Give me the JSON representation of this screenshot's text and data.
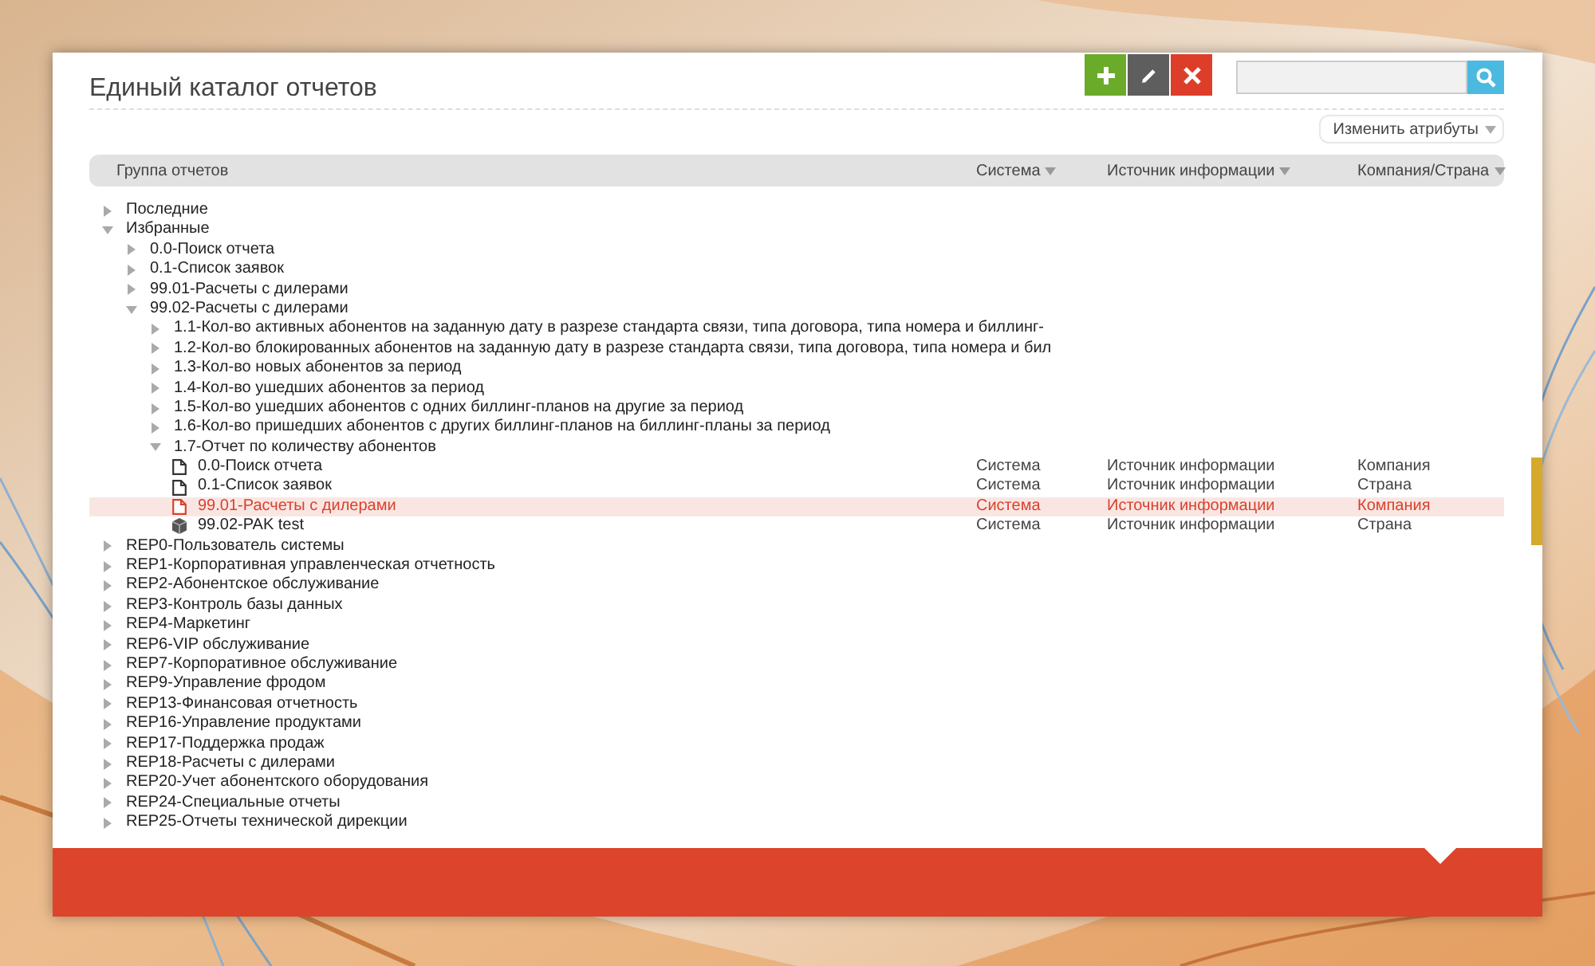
{
  "title": "Единый каталог отчетов",
  "toolbar": [
    {
      "kind": "add"
    },
    {
      "kind": "edit"
    },
    {
      "kind": "delete"
    }
  ],
  "attributes_button": "Изменить атрибуты",
  "columns": [
    {
      "label": "Группа отчетов",
      "sortable": false
    },
    {
      "label": "Система",
      "sortable": true
    },
    {
      "label": "Источник информации",
      "sortable": true
    },
    {
      "label": "Компания/Страна",
      "sortable": true
    }
  ],
  "tree": [
    {
      "label": "Последние",
      "kind": "folder",
      "expanded": false
    },
    {
      "label": "Избранные",
      "kind": "folder",
      "expanded": true,
      "children": [
        {
          "label": "0.0-Поиск отчета",
          "kind": "folder",
          "expanded": false
        },
        {
          "label": "0.1-Список заявок",
          "kind": "folder",
          "expanded": false
        },
        {
          "label": "99.01-Расчеты с дилерами",
          "kind": "folder",
          "expanded": false
        },
        {
          "label": "99.02-Расчеты с дилерами",
          "kind": "folder",
          "expanded": true,
          "children": [
            {
              "label": "1.1-Кол-во активных абонентов на заданную дату в разрезе стандарта связи, типа договора, типа номера и биллинг-",
              "kind": "folder",
              "expanded": false
            },
            {
              "label": "1.2-Кол-во блокированных абонентов на заданную дату в разрезе стандарта связи, типа договора, типа номера и бил",
              "kind": "folder",
              "expanded": false
            },
            {
              "label": "1.3-Кол-во новых абонентов за период",
              "kind": "folder",
              "expanded": false
            },
            {
              "label": "1.4-Кол-во ушедших абонентов за период",
              "kind": "folder",
              "expanded": false
            },
            {
              "label": "1.5-Кол-во ушедших абонентов с одних биллинг-планов на другие за период",
              "kind": "folder",
              "expanded": false
            },
            {
              "label": "1.6-Кол-во пришедших абонентов с других биллинг-планов на биллинг-планы за период",
              "kind": "folder",
              "expanded": false
            },
            {
              "label": "1.7-Отчет по количеству абонентов",
              "kind": "folder",
              "expanded": true,
              "children": [
                {
                  "label": "0.0-Поиск отчета",
                  "kind": "report",
                  "selected": false,
                  "system": "Система",
                  "source": "Источник информации",
                  "company": "Компания"
                },
                {
                  "label": "0.1-Список заявок",
                  "kind": "report",
                  "selected": false,
                  "system": "Система",
                  "source": "Источник информации",
                  "company": "Страна"
                },
                {
                  "label": "99.01-Расчеты с дилерами",
                  "kind": "report",
                  "selected": true,
                  "system": "Система",
                  "source": "Источник информации",
                  "company": "Компания"
                },
                {
                  "label": "99.02-PAK test",
                  "kind": "package",
                  "selected": false,
                  "system": "Система",
                  "source": "Источник информации",
                  "company": "Страна"
                }
              ]
            }
          ]
        }
      ]
    },
    {
      "label": "REP0-Пользователь системы",
      "kind": "folder",
      "expanded": false
    },
    {
      "label": "REP1-Корпоративная управленческая отчетность",
      "kind": "folder",
      "expanded": false
    },
    {
      "label": "REP2-Абонентское обслуживание",
      "kind": "folder",
      "expanded": false
    },
    {
      "label": "REP3-Контроль базы данных",
      "kind": "folder",
      "expanded": false
    },
    {
      "label": "REP4-Маркетинг",
      "kind": "folder",
      "expanded": false
    },
    {
      "label": "REP6-VIP обслуживание",
      "kind": "folder",
      "expanded": false
    },
    {
      "label": "REP7-Корпоративное обслуживание",
      "kind": "folder",
      "expanded": false
    },
    {
      "label": "REP9-Управление фродом",
      "kind": "folder",
      "expanded": false
    },
    {
      "label": "REP13-Финансовая отчетность",
      "kind": "folder",
      "expanded": false
    },
    {
      "label": "REP16-Управление продуктами",
      "kind": "folder",
      "expanded": false
    },
    {
      "label": "REP17-Поддержка продаж",
      "kind": "folder",
      "expanded": false
    },
    {
      "label": "REP18-Расчеты с дилерами",
      "kind": "folder",
      "expanded": false
    },
    {
      "label": "REP20-Учет абонентского оборудования",
      "kind": "folder",
      "expanded": false
    },
    {
      "label": "REP24-Специальные отчеты",
      "kind": "folder",
      "expanded": false
    },
    {
      "label": "REP25-Отчеты технической дирекции",
      "kind": "folder",
      "expanded": false
    }
  ]
}
